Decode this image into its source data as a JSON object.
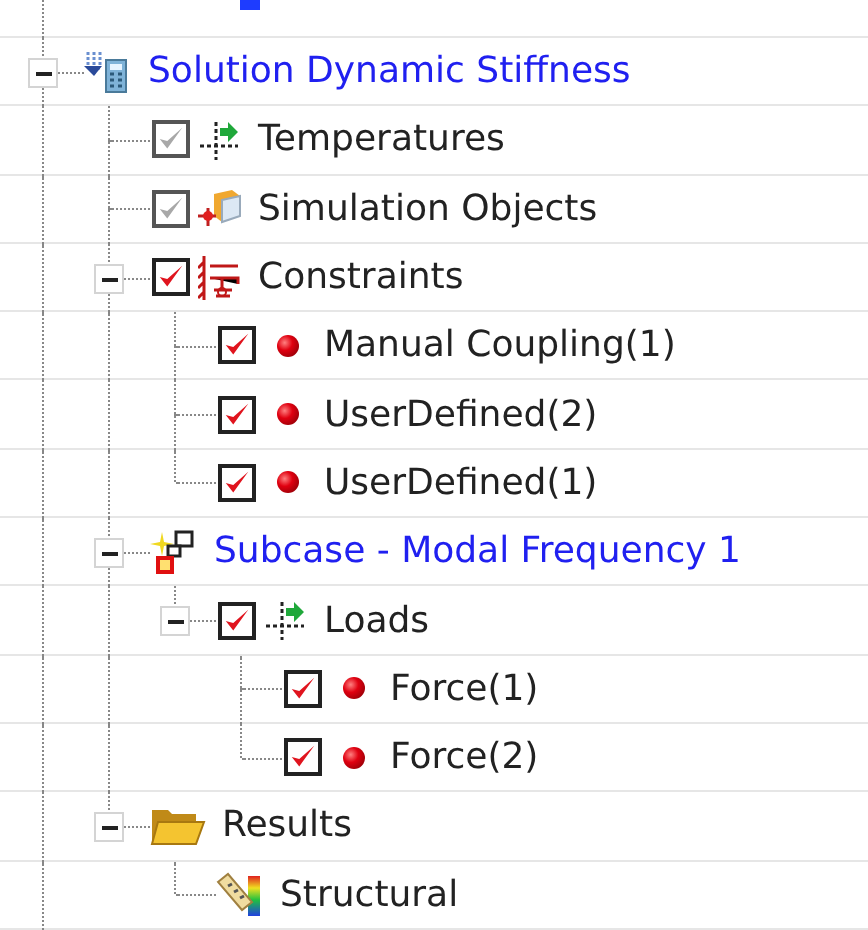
{
  "tree": [
    {
      "label": "Solution Dynamic Stiffness",
      "kind": "solution",
      "active": true,
      "expanded": true,
      "children": [
        {
          "label": "Temperatures",
          "kind": "temperatures",
          "active": false,
          "checkbox": {
            "checked": true,
            "disabled": true
          }
        },
        {
          "label": "Simulation Objects",
          "kind": "simulation-objects",
          "active": false,
          "checkbox": {
            "checked": true,
            "disabled": true
          }
        },
        {
          "label": "Constraints",
          "kind": "constraints",
          "active": false,
          "checkbox": {
            "checked": true,
            "disabled": false
          },
          "expanded": true,
          "children": [
            {
              "label": "Manual Coupling(1)",
              "kind": "item",
              "active": false,
              "checkbox": {
                "checked": true,
                "disabled": false
              }
            },
            {
              "label": "UserDefined(2)",
              "kind": "item",
              "active": false,
              "checkbox": {
                "checked": true,
                "disabled": false
              }
            },
            {
              "label": "UserDefined(1)",
              "kind": "item",
              "active": false,
              "checkbox": {
                "checked": true,
                "disabled": false
              }
            }
          ]
        },
        {
          "label": "Subcase - Modal Frequency 1",
          "kind": "subcase",
          "active": true,
          "expanded": true,
          "children": [
            {
              "label": "Loads",
              "kind": "loads",
              "active": false,
              "checkbox": {
                "checked": true,
                "disabled": false
              },
              "expanded": true,
              "children": [
                {
                  "label": "Force(1)",
                  "kind": "item",
                  "active": false,
                  "checkbox": {
                    "checked": true,
                    "disabled": false
                  }
                },
                {
                  "label": "Force(2)",
                  "kind": "item",
                  "active": false,
                  "checkbox": {
                    "checked": true,
                    "disabled": false
                  }
                }
              ]
            }
          ]
        },
        {
          "label": "Results",
          "kind": "results",
          "active": false,
          "expanded": true,
          "children": [
            {
              "label": "Structural",
              "kind": "structural",
              "active": false
            }
          ]
        }
      ]
    }
  ]
}
